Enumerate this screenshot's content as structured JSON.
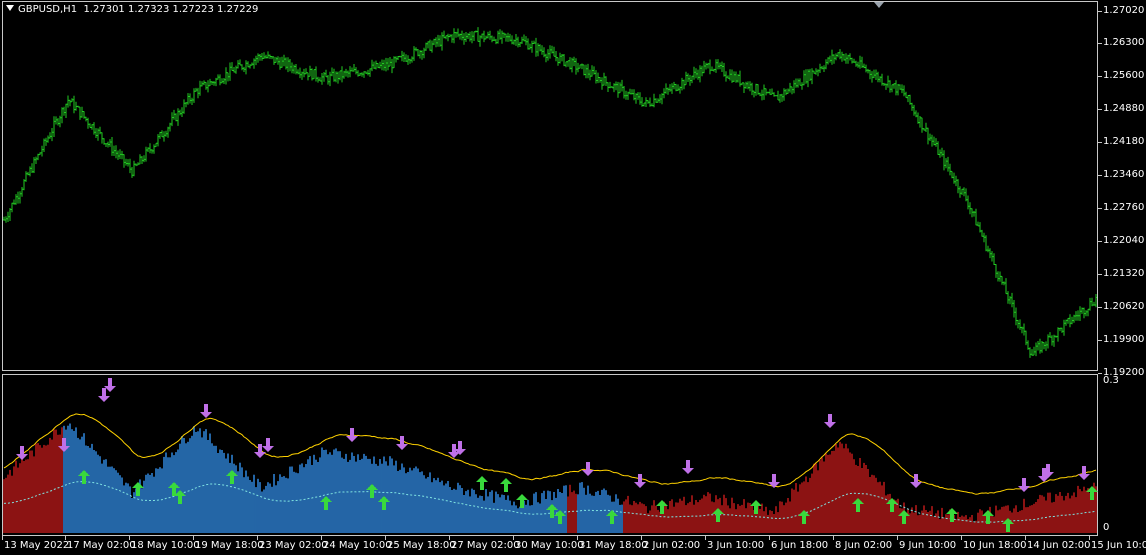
{
  "chart_header": {
    "symbol_tf": "GBPUSD,H1",
    "quotes": "1.27301 1.27323 1.27223 1.27229"
  },
  "price_axis": [
    "1.27020",
    "1.26300",
    "1.25600",
    "1.24880",
    "1.24180",
    "1.23460",
    "1.22760",
    "1.22040",
    "1.21320",
    "1.20620",
    "1.19900",
    "1.19200"
  ],
  "indicator_axis": {
    "top": "0.3",
    "bottom": "0"
  },
  "time_axis": [
    "13 May 2022",
    "17 May 02:00",
    "18 May 10:00",
    "19 May 18:00",
    "23 May 02:00",
    "24 May 10:00",
    "25 May 18:00",
    "27 May 02:00",
    "30 May 10:00",
    "31 May 18:00",
    "2 Jun 02:00",
    "3 Jun 10:00",
    "6 Jun 18:00",
    "8 Jun 02:00",
    "9 Jun 10:00",
    "10 Jun 18:00",
    "14 Jun 02:00",
    "15 Jun 10:00"
  ],
  "colors": {
    "candles": "#22cc22",
    "hist_red": "#b01818",
    "hist_blue": "#2e7fd0",
    "line_yellow": "#ffd200",
    "line_cyan": "#7fe3e0",
    "arrow_down": "#c070e8",
    "arrow_up": "#39d93c",
    "grid_border": "#c8c8c8"
  },
  "chart_data": [
    {
      "type": "line",
      "title": "GBPUSD,H1",
      "ylim": [
        1.192,
        1.2702
      ],
      "x": [
        "13 May 2022",
        "17 May 02:00",
        "18 May 10:00",
        "19 May 18:00",
        "23 May 02:00",
        "24 May 10:00",
        "25 May 18:00",
        "27 May 02:00",
        "30 May 10:00",
        "31 May 18:00",
        "2 Jun 02:00",
        "3 Jun 10:00",
        "6 Jun 18:00",
        "8 Jun 02:00",
        "9 Jun 10:00",
        "10 Jun 18:00",
        "14 Jun 02:00",
        "15 Jun 10:00"
      ],
      "series": [
        {
          "values": [
            1.224,
            1.25,
            1.2345,
            1.252,
            1.2595,
            1.2545,
            1.2575,
            1.264,
            1.263,
            1.2565,
            1.249,
            1.2575,
            1.25,
            1.26,
            1.2515,
            1.228,
            1.195,
            1.207
          ]
        }
      ]
    },
    {
      "type": "area",
      "ylim": [
        0,
        0.3
      ],
      "x": [
        "13 May 2022",
        "17 May 02:00",
        "18 May 10:00",
        "19 May 18:00",
        "23 May 02:00",
        "24 May 10:00",
        "25 May 18:00",
        "27 May 02:00",
        "30 May 10:00",
        "31 May 18:00",
        "2 Jun 02:00",
        "3 Jun 10:00",
        "6 Jun 18:00",
        "8 Jun 02:00",
        "9 Jun 10:00",
        "10 Jun 18:00",
        "14 Jun 02:00",
        "15 Jun 10:00"
      ],
      "series": [
        {
          "values": [
            0.11,
            0.22,
            0.08,
            0.21,
            0.09,
            0.16,
            0.14,
            0.09,
            0.06,
            0.09,
            0.05,
            0.07,
            0.04,
            0.18,
            0.05,
            0.03,
            0.06,
            0.09
          ]
        }
      ]
    }
  ]
}
